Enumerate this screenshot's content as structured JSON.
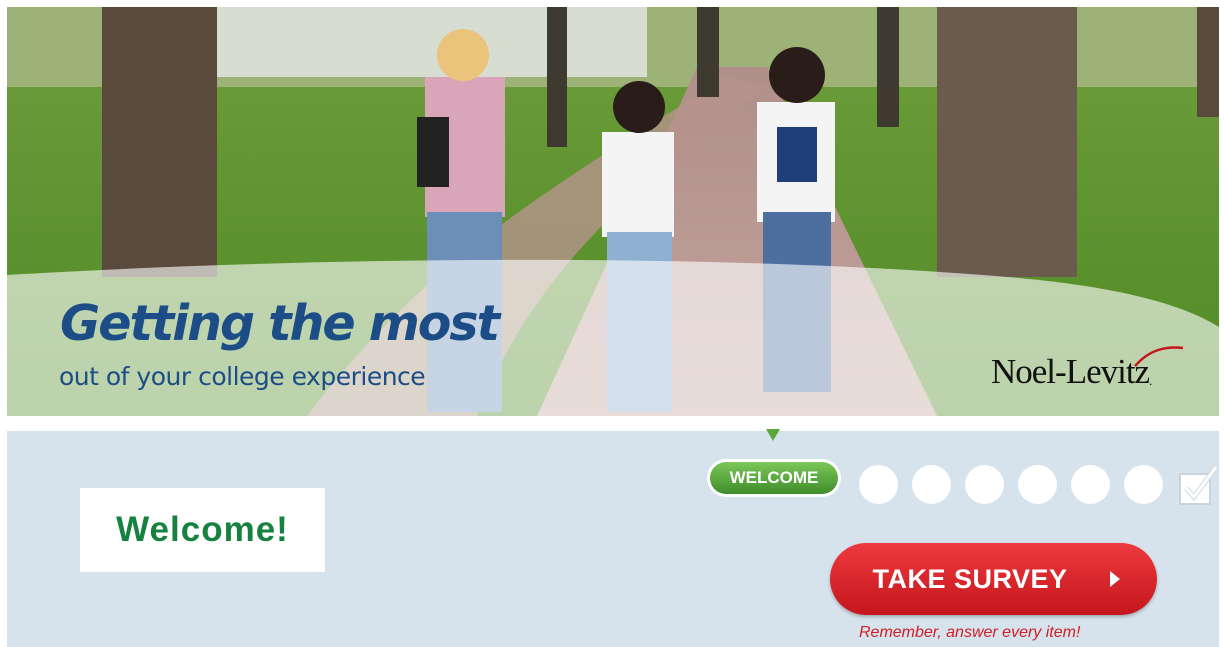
{
  "banner": {
    "title": "Getting the most",
    "subtitle": "out of your college experience",
    "brand": "Noel-Levitz",
    "brand_mark": ".",
    "photo_description": "students-walking-on-campus-path"
  },
  "progress": {
    "current_step_label": "WELCOME",
    "remaining_steps": 6,
    "final_step_icon": "checkbox-check-icon"
  },
  "main": {
    "heading": "Welcome!"
  },
  "actions": {
    "take_survey_label": "TAKE SURVEY",
    "reminder": "Remember, answer every item!"
  },
  "colors": {
    "title_blue": "#1c4d86",
    "welcome_green": "#17823f",
    "pill_green": "#4fa437",
    "button_red": "#d62328",
    "panel_bg": "#d6e2ec"
  }
}
